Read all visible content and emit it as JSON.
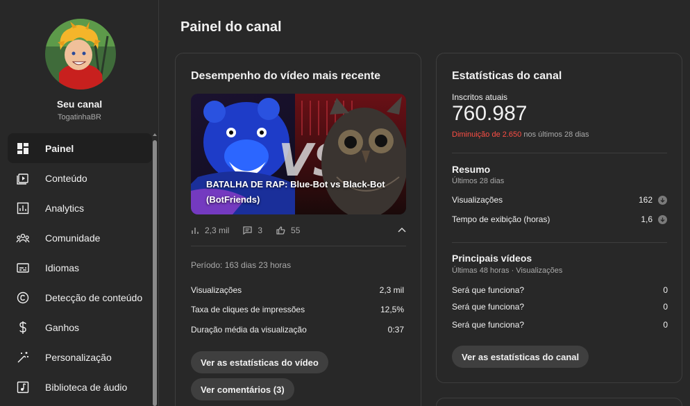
{
  "channel": {
    "title": "Seu canal",
    "handle": "TogatinhaBR"
  },
  "sidebar": {
    "items": [
      {
        "label": "Painel",
        "icon": "dashboard-icon",
        "active": true
      },
      {
        "label": "Conteúdo",
        "icon": "content-icon"
      },
      {
        "label": "Analytics",
        "icon": "analytics-icon"
      },
      {
        "label": "Comunidade",
        "icon": "community-icon"
      },
      {
        "label": "Idiomas",
        "icon": "subtitles-icon"
      },
      {
        "label": "Detecção de conteúdo",
        "icon": "copyright-icon"
      },
      {
        "label": "Ganhos",
        "icon": "dollar-icon"
      },
      {
        "label": "Personalização",
        "icon": "magic-wand-icon"
      },
      {
        "label": "Biblioteca de áudio",
        "icon": "audio-library-icon"
      }
    ]
  },
  "page": {
    "title": "Painel do canal"
  },
  "latest_video": {
    "heading": "Desempenho do vídeo mais recente",
    "title": "BATALHA DE RAP: Blue-Bot vs Black-Bot (BotFriends)",
    "views_short": "2,3 mil",
    "comments": "3",
    "likes": "55",
    "period": "Período: 163 dias 23 horas",
    "metrics": [
      {
        "label": "Visualizações",
        "value": "2,3 mil"
      },
      {
        "label": "Taxa de cliques de impressões",
        "value": "12,5%"
      },
      {
        "label": "Duração média da visualização",
        "value": "0:37"
      }
    ],
    "btn_stats": "Ver as estatísticas do vídeo",
    "btn_comments": "Ver comentários (3)"
  },
  "channel_stats": {
    "heading": "Estatísticas do canal",
    "subs_label": "Inscritos atuais",
    "subs_count": "760.987",
    "subs_change": "Diminuição de 2.650",
    "subs_change_suffix": " nos últimos 28 dias",
    "summary_title": "Resumo",
    "summary_sub": "Últimos 28 dias",
    "summary_rows": [
      {
        "label": "Visualizações",
        "value": "162"
      },
      {
        "label": "Tempo de exibição (horas)",
        "value": "1,6"
      }
    ],
    "top_title": "Principais vídeos",
    "top_sub": "Últimas 48 horas · Visualizações",
    "top_rows": [
      {
        "label": "Será que funciona?",
        "value": "0"
      },
      {
        "label": "Será que funciona?",
        "value": "0"
      },
      {
        "label": "Será que funciona?",
        "value": "0"
      }
    ],
    "btn": "Ver as estatísticas do canal"
  },
  "colors": {
    "background": "#282828",
    "card_border": "#3e3e3e",
    "negative": "#ff4e45",
    "pill": "#3f3f3f"
  }
}
